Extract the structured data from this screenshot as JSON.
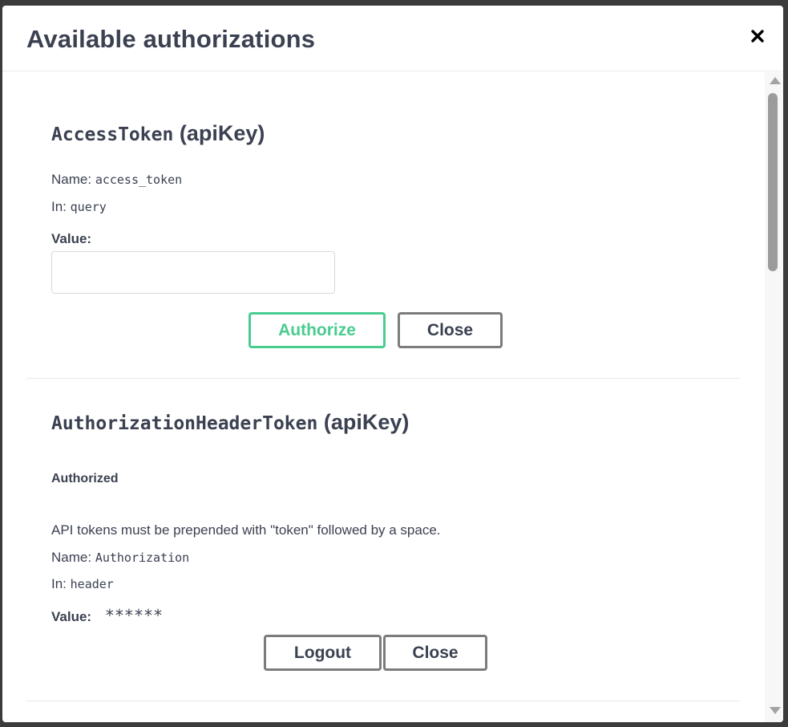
{
  "modal": {
    "title": "Available authorizations",
    "close_icon": "close-x-icon"
  },
  "auths": [
    {
      "name": "AccessToken",
      "type": "(apiKey)",
      "name_label": "Name:",
      "name_value": "access_token",
      "in_label": "In:",
      "in_value": "query",
      "value_label": "Value:",
      "value_input": "",
      "authorize_label": "Authorize",
      "close_label": "Close"
    },
    {
      "name": "AuthorizationHeaderToken",
      "type": "(apiKey)",
      "status": "Authorized",
      "description": "API tokens must be prepended with \"token\" followed by a space.",
      "name_label": "Name:",
      "name_value": "Authorization",
      "in_label": "In:",
      "in_value": "header",
      "value_label": "Value:",
      "value_masked": "******",
      "logout_label": "Logout",
      "close_label": "Close"
    }
  ],
  "colors": {
    "accent_green": "#49cc90",
    "text": "#3b4151",
    "button_border": "#7c7c7c"
  }
}
